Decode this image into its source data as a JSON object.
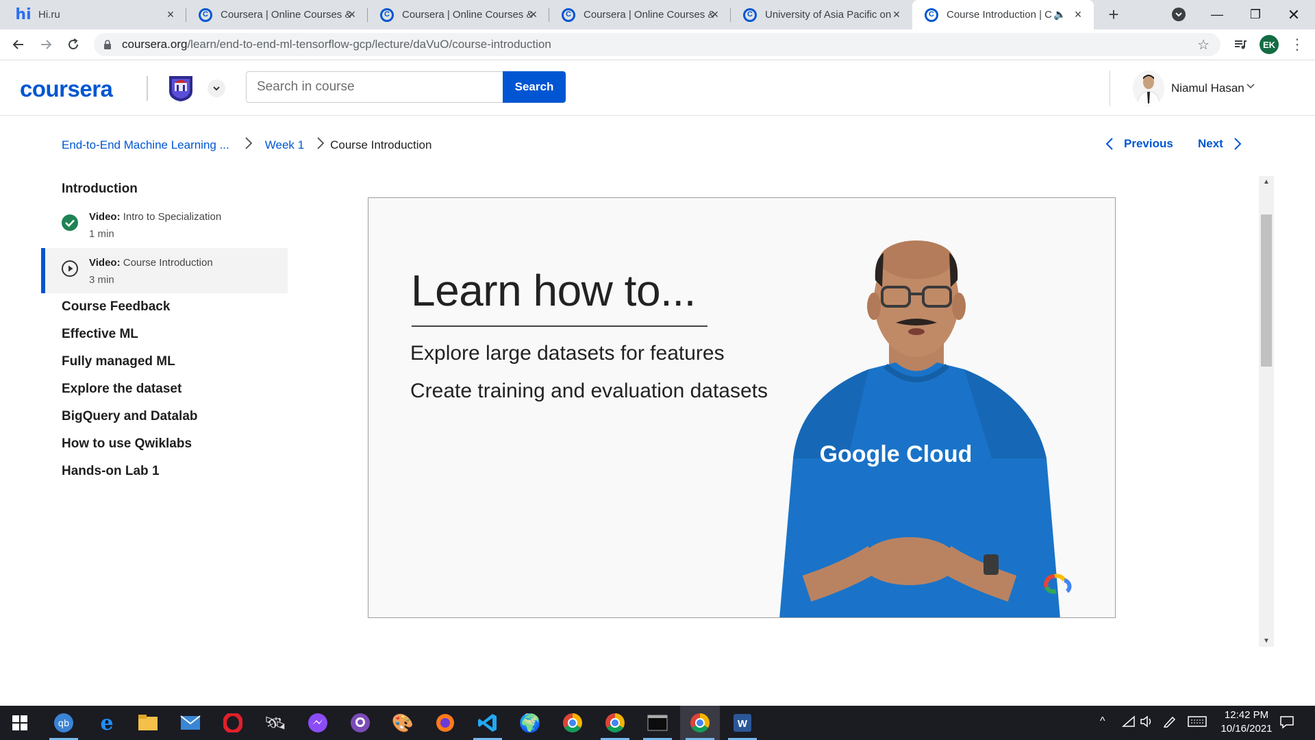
{
  "browser": {
    "tabs": [
      {
        "title": "Hi.ru",
        "favicon": "hi-icon"
      },
      {
        "title": "Coursera | Online Courses &",
        "favicon": "coursera-icon"
      },
      {
        "title": "Coursera | Online Courses &",
        "favicon": "coursera-icon"
      },
      {
        "title": "Coursera | Online Courses &",
        "favicon": "coursera-icon"
      },
      {
        "title": "University of Asia Pacific on",
        "favicon": "coursera-icon"
      },
      {
        "title": "Course Introduction | C",
        "favicon": "coursera-icon",
        "active": true
      }
    ],
    "url_host": "coursera.org",
    "url_path": "/learn/end-to-end-ml-tensorflow-gcp/lecture/daVuO/course-introduction",
    "profile_initials": "EK"
  },
  "header": {
    "logo_text": "coursera",
    "search_placeholder": "Search in course",
    "search_button": "Search",
    "user_name": "Niamul Hasan"
  },
  "breadcrumb": {
    "course": "End-to-End Machine Learning ...",
    "week": "Week 1",
    "current": "Course Introduction"
  },
  "nav": {
    "previous": "Previous",
    "next": "Next"
  },
  "sidebar": {
    "section": "Introduction",
    "lessons": [
      {
        "type": "Video:",
        "title": "Intro to Specialization",
        "duration": "1 min",
        "status": "completed"
      },
      {
        "type": "Video:",
        "title": "Course Introduction",
        "duration": "3 min",
        "status": "current"
      }
    ],
    "sections": [
      "Course Feedback",
      "Effective ML",
      "Fully managed ML",
      "Explore the dataset",
      "BigQuery and Datalab",
      "How to use Qwiklabs",
      "Hands-on Lab 1"
    ]
  },
  "video": {
    "headline": "Learn how to...",
    "bullets": [
      "Explore large datasets for features",
      "Create training and evaluation datasets"
    ],
    "shirt_text": "Google Cloud"
  },
  "taskbar": {
    "time": "12:42 PM",
    "date": "10/16/2021"
  },
  "colors": {
    "brand": "#0056d2",
    "complete": "#1f8354"
  }
}
